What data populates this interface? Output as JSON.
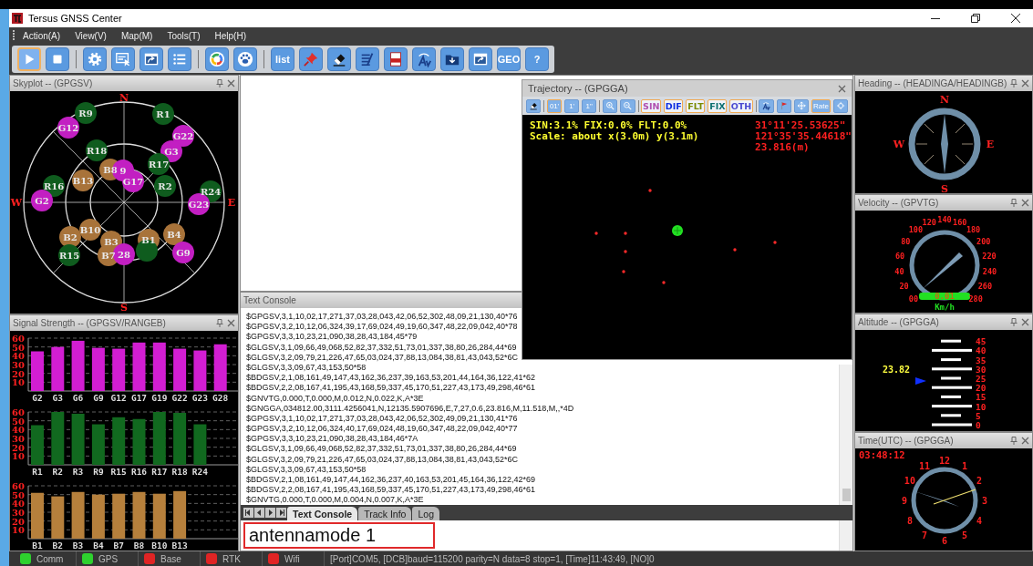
{
  "window": {
    "title": "Tersus GNSS Center"
  },
  "menu": [
    "Action(A)",
    "View(V)",
    "Map(M)",
    "Tools(T)",
    "Help(H)"
  ],
  "toolbar": [
    [
      {
        "kind": "play",
        "selected": true
      },
      {
        "kind": "stop",
        "selected": false
      }
    ],
    [
      {
        "kind": "settings",
        "selected": false
      },
      {
        "kind": "window-cursor",
        "selected": false
      },
      {
        "kind": "window-arrow",
        "selected": false
      },
      {
        "kind": "list",
        "selected": false
      }
    ],
    [
      {
        "kind": "ring",
        "selected": false
      },
      {
        "kind": "paw",
        "selected": false
      }
    ],
    [
      {
        "kind": "text",
        "label": "list",
        "selected": false
      },
      {
        "kind": "pin",
        "selected": false
      },
      {
        "kind": "eraser",
        "selected": false
      },
      {
        "kind": "notes",
        "selected": false
      },
      {
        "kind": "document",
        "selected": false
      },
      {
        "kind": "antenna",
        "selected": false
      },
      {
        "kind": "folder",
        "selected": false
      },
      {
        "kind": "upload",
        "selected": false
      },
      {
        "kind": "text",
        "label": "GEO",
        "selected": false
      },
      {
        "kind": "text",
        "label": "?",
        "selected": false
      }
    ]
  ],
  "skyplot": {
    "title": "Skyplot -- (GPGSV)",
    "directions": [
      "N",
      "E",
      "S",
      "W"
    ],
    "satellites": [
      {
        "label": "R9",
        "color": "#0f5c1e"
      },
      {
        "label": "R1",
        "color": "#0f5c1e"
      },
      {
        "label": "G12",
        "color": "#c21fc2"
      },
      {
        "label": "G22",
        "color": "#c21fc2"
      },
      {
        "label": "R18",
        "color": "#0f5c1e"
      },
      {
        "label": "G3",
        "color": "#c21fc2"
      },
      {
        "label": "R17",
        "color": "#0f5c1e"
      },
      {
        "label": "B8",
        "color": "#a8733a"
      },
      {
        "label": "9",
        "color": "#c21fc2"
      },
      {
        "label": "R16",
        "color": "#0f5c1e"
      },
      {
        "label": "B13",
        "color": "#a8733a"
      },
      {
        "label": "G17",
        "color": "#c21fc2"
      },
      {
        "label": "R2",
        "color": "#0f5c1e"
      },
      {
        "label": "R24",
        "color": "#0f5c1e"
      },
      {
        "label": "G2",
        "color": "#c21fc2"
      },
      {
        "label": "G23",
        "color": "#c21fc2"
      },
      {
        "label": "B2",
        "color": "#a8733a"
      },
      {
        "label": "B10",
        "color": "#a8733a"
      },
      {
        "label": "B3",
        "color": "#a8733a"
      },
      {
        "label": "B1",
        "color": "#a8733a"
      },
      {
        "label": "B4",
        "color": "#a8733a"
      },
      {
        "label": "R15",
        "color": "#0f5c1e"
      },
      {
        "label": "B7",
        "color": "#a8733a"
      },
      {
        "label": "28",
        "color": "#c21fc2"
      },
      {
        "color": "#0f5c1e"
      },
      {
        "label": "G9",
        "color": "#c21fc2"
      }
    ]
  },
  "signal_strength": {
    "title": "Signal Strength -- (GPGSV/RANGEB)",
    "charts": [
      {
        "chart_data": {
          "type": "bar",
          "categories": [
            "G2",
            "G3",
            "G6",
            "G9",
            "G12",
            "G17",
            "G19",
            "G22",
            "G23",
            "G28"
          ],
          "series": [
            {
              "color": "#d21ed2",
              "values": [
                45,
                50,
                57,
                49,
                48,
                55,
                55,
                48,
                46,
                53
              ]
            }
          ],
          "ylim": [
            0,
            60
          ],
          "yticks": [
            {
              "value": 60,
              "label": "60"
            },
            {
              "value": 50,
              "label": "50"
            },
            {
              "value": 40,
              "label": "40"
            },
            {
              "value": 30,
              "label": "30"
            },
            {
              "value": 20,
              "label": "20"
            },
            {
              "value": 10,
              "label": "10"
            }
          ],
          "grid": true
        }
      },
      {
        "chart_data": {
          "type": "bar",
          "categories": [
            "R1",
            "R2",
            "R3",
            "R9",
            "R15",
            "R16",
            "R17",
            "R18",
            "R24"
          ],
          "series": [
            {
              "color": "#11691f",
              "values": [
                45,
                60,
                58,
                46,
                54,
                52,
                60,
                59,
                46
              ]
            }
          ],
          "ylim": [
            0,
            60
          ],
          "yticks": [
            {
              "value": 60,
              "label": "60"
            },
            {
              "value": 50,
              "label": "50"
            },
            {
              "value": 40,
              "label": "40"
            },
            {
              "value": 30,
              "label": "30"
            },
            {
              "value": 20,
              "label": "20"
            },
            {
              "value": 10,
              "label": "10"
            }
          ],
          "grid": true
        }
      },
      {
        "chart_data": {
          "type": "bar",
          "categories": [
            "B1",
            "B2",
            "B3",
            "B4",
            "B7",
            "B8",
            "B10",
            "B13"
          ],
          "series": [
            {
              "color": "#b6803c",
              "values": [
                52,
                48,
                53,
                50,
                51,
                53,
                51,
                54
              ]
            }
          ],
          "ylim": [
            0,
            60
          ],
          "yticks": [
            {
              "value": 60,
              "label": "60"
            },
            {
              "value": 50,
              "label": "50"
            },
            {
              "value": 40,
              "label": "40"
            },
            {
              "value": 30,
              "label": "30"
            },
            {
              "value": 20,
              "label": "20"
            },
            {
              "value": 10,
              "label": "10"
            }
          ],
          "grid": true
        }
      }
    ]
  },
  "text_console": {
    "title": "Text Console",
    "lines": [
      "$GPGSV,3,1,10,02,17,271,37,03,28,043,42,06,52,302,48,09,21,130,40*76",
      "$GPGSV,3,2,10,12,06,324,39,17,69,024,49,19,60,347,48,22,09,042,40*78",
      "$GPGSV,3,3,10,23,21,090,38,28,43,184,45*79",
      "$GLGSV,3,1,09,66,49,068,52,82,37,332,51,73,01,337,38,80,26,284,44*69",
      "$GLGSV,3,2,09,79,21,226,47,65,03,024,37,88,13,084,38,81,43,043,52*6C",
      "$GLGSV,3,3,09,67,43,153,50*58",
      "$BDGSV,2,1,08,161,49,147,43,162,36,237,39,163,53,201,44,164,36,122,41*62",
      "$BDGSV,2,2,08,167,41,195,43,168,59,337,45,170,51,227,43,173,49,298,46*61",
      "$GNVTG,0.000,T,0.000,M,0.012,N,0.022,K,A*3E",
      "$GNGGA,034812.00,3111.4256041,N,12135.5907696,E,7,27,0.6,23.816,M,11.518,M,,*4D",
      "$GPGSV,3,1,10,02,17,271,37,03,28,043,42,06,52,302,49,09,21,130,41*76",
      "$GPGSV,3,2,10,12,06,324,40,17,69,024,48,19,60,347,48,22,09,042,40*77",
      "$GPGSV,3,3,10,23,21,090,38,28,43,184,46*7A",
      "$GLGSV,3,1,09,66,49,068,52,82,37,332,51,73,01,337,38,80,26,284,44*69",
      "$GLGSV,3,2,09,79,21,226,47,65,03,024,37,88,13,084,38,81,43,043,52*6C",
      "$GLGSV,3,3,09,67,43,153,50*58",
      "$BDGSV,2,1,08,161,49,147,44,162,36,237,40,163,53,201,45,164,36,122,42*69",
      "$BDGSV,2,2,08,167,41,195,43,168,59,337,45,170,51,227,43,173,49,298,46*61",
      "$GNVTG,0.000,T,0.000,M,0.004,N,0.007,K,A*3E"
    ],
    "tabs": [
      {
        "label": "Text Console",
        "selected": true
      },
      {
        "label": "Track Info",
        "selected": false
      },
      {
        "label": "Log",
        "selected": false
      }
    ],
    "input": {
      "value": "antennamode 1"
    }
  },
  "trajectory": {
    "title": "Trajectory -- (GPGGA)",
    "toolbar": [
      [
        {
          "kind": "eraser",
          "selected": false
        }
      ],
      [
        {
          "kind": "text",
          "label": "01'",
          "selected": true
        },
        {
          "kind": "text",
          "label": "1'",
          "selected": false
        },
        {
          "kind": "text",
          "label": "1\"",
          "selected": false
        }
      ],
      [
        {
          "kind": "zoom-in",
          "selected": false
        },
        {
          "kind": "zoom-out",
          "selected": false
        }
      ],
      [
        {
          "kind": "text",
          "label": "SIN",
          "selected": true,
          "color": "#b050b0"
        },
        {
          "kind": "text",
          "label": "DIF",
          "selected": true,
          "color": "#1030e0"
        },
        {
          "kind": "text",
          "label": "FLT",
          "selected": true,
          "color": "#7a8a00"
        },
        {
          "kind": "text",
          "label": "FIX",
          "selected": true,
          "color": "#0a6e6e"
        },
        {
          "kind": "text",
          "label": "OTH",
          "selected": true,
          "color": "#4a4ad0"
        }
      ],
      [
        {
          "kind": "antenna",
          "selected": false
        },
        {
          "kind": "flag",
          "selected": false
        },
        {
          "kind": "move",
          "selected": false
        },
        {
          "kind": "text",
          "label": "Rate",
          "selected": true
        },
        {
          "kind": "target",
          "selected": false
        }
      ]
    ],
    "stats": "SIN:3.1% FIX:0.0% FLT:0.0%",
    "scale": "Scale: about x(3.0m) y(3.1m)",
    "latitude": "31°11'25.53625\"",
    "longitude": "121°35'35.44618\"",
    "height": "23.816(m)"
  },
  "heading": {
    "title": "Heading -- (HEADINGA/HEADINGB)",
    "directions": [
      "N",
      "E",
      "S",
      "W"
    ]
  },
  "velocity": {
    "title": "Velocity -- (GPVTG)",
    "scale": [
      "00",
      "20",
      "40",
      "60",
      "80",
      "100",
      "120",
      "140",
      "160",
      "180",
      "200",
      "220",
      "240",
      "260",
      "280"
    ],
    "reading": "0.01",
    "unit": "Km/h"
  },
  "altitude": {
    "title": "Altitude -- (GPGGA)",
    "scale": [
      "45",
      "40",
      "35",
      "30",
      "25",
      "20",
      "15",
      "10",
      "5",
      "0"
    ],
    "reading": "23.82"
  },
  "time_utc": {
    "title": "Time(UTC) -- (GPGGA)",
    "clock": "03:48:12",
    "numbers": [
      "12",
      "1",
      "2",
      "3",
      "4",
      "5",
      "6",
      "7",
      "8",
      "9",
      "10",
      "11"
    ]
  },
  "status_bar": {
    "indicators": [
      {
        "label": "Comm",
        "color": "#2ed12e"
      },
      {
        "label": "GPS",
        "color": "#2ed12e"
      },
      {
        "label": "Base",
        "color": "#e02424"
      },
      {
        "label": "RTK",
        "color": "#e02424"
      },
      {
        "label": "Wifi",
        "color": "#e02424"
      }
    ],
    "info": "[Port]COM5, [DCB]baud=115200 parity=N data=8 stop=1, [Time]11:43:49, [NO]0"
  }
}
